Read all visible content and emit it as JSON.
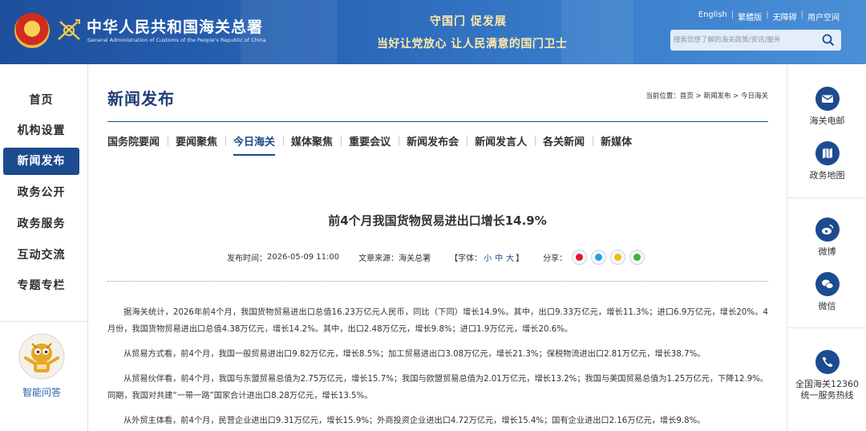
{
  "header": {
    "site_title": "中华人民共和国海关总署",
    "site_subtitle": "General Administration of Customs of the People's Republic of China",
    "slogan_line1": "守国门  促发展",
    "slogan_line2": "当好让党放心  让人民满意的国门卫士",
    "links": [
      "English",
      "繁體版",
      "无障碍",
      "用户空间"
    ],
    "search_placeholder": "搜索您想了解的海关政策/资讯/服务",
    "colors": {
      "header_blue": "#2a67b8",
      "slogan_gold": "#ffe9a8"
    }
  },
  "leftnav": {
    "items": [
      "首页",
      "机构设置",
      "新闻发布",
      "政务公开",
      "政务服务",
      "互动交流",
      "专题专栏"
    ],
    "active_index": 2,
    "ai_label": "智能问答",
    "colors": {
      "active_bg": "#1d4b8f"
    }
  },
  "main": {
    "heading": "新闻发布",
    "breadcrumb": {
      "prefix": "当前位置：",
      "items": [
        "首页",
        "新闻发布",
        "今日海关"
      ],
      "separator": " > "
    },
    "tabs": [
      "国务院要闻",
      "要闻聚焦",
      "今日海关",
      "媒体聚焦",
      "重要会议",
      "新闻发布会",
      "新闻发言人",
      "各关新闻",
      "新媒体"
    ],
    "active_tab": 2,
    "article": {
      "title": "前4个月我国货物贸易进出口增长14.9%",
      "publish_label": "发布时间：",
      "publish_time": "2026-05-09 11:00",
      "source_label": "文章来源：",
      "source": "海关总署",
      "font_label_open": "【字体：",
      "font_sizes": [
        "小",
        "中",
        "大"
      ],
      "font_label_close": "】",
      "share_label": "分享：",
      "share_icons": [
        "weibo-icon",
        "qq-icon",
        "qzone-icon",
        "wechat-icon"
      ],
      "paragraphs": [
        "据海关统计，2026年前4个月，我国货物贸易进出口总值16.23万亿元人民币，同比（下同）增长14.9%。其中，出口9.33万亿元，增长11.3%；进口6.9万亿元，增长20%。4月份，我国货物贸易进出口总值4.38万亿元，增长14.2%。其中，出口2.48万亿元，增长9.8%；进口1.9万亿元，增长20.6%。",
        "从贸易方式看，前4个月，我国一般贸易进出口9.82万亿元，增长8.5%；加工贸易进出口3.08万亿元，增长21.3%；保税物流进出口2.81万亿元，增长38.7%。",
        "从贸易伙伴看，前4个月，我国与东盟贸易总值为2.75万亿元，增长15.7%；我国与欧盟贸易总值为2.01万亿元，增长13.2%；我国与美国贸易总值为1.25万亿元，下降12.9%。同期，我国对共建“一带一路”国家合计进出口8.28万亿元，增长13.5%。",
        "从外贸主体看，前4个月，民营企业进出口9.31万亿元，增长15.9%；外商投资企业进出口4.72万亿元，增长15.4%；国有企业进出口2.16万亿元，增长9.8%。"
      ]
    }
  },
  "rightbar": {
    "items": [
      {
        "label": "海关电邮",
        "icon": "mail-icon"
      },
      {
        "label": "政务地图",
        "icon": "map-icon"
      },
      {
        "label": "微博",
        "icon": "weibo-icon"
      },
      {
        "label": "微信",
        "icon": "wechat-icon"
      },
      {
        "label": "全国海关12360统一服务热线",
        "icon": "phone-icon"
      }
    ]
  }
}
